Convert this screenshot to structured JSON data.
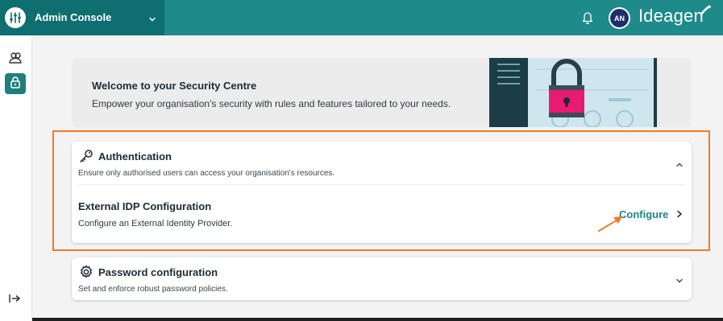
{
  "header": {
    "app_title": "Admin Console",
    "brand": "Ideagen",
    "avatar_initials": "AN",
    "colors": {
      "bar": "#1f8a8a",
      "switcher": "#0e6e70",
      "avatar": "#1b2f6e"
    }
  },
  "sidebar": {
    "items": [
      {
        "name": "users",
        "icon": "users-icon"
      },
      {
        "name": "security",
        "icon": "lock-icon",
        "active": true
      }
    ],
    "footer_icon": "expand-icon"
  },
  "banner": {
    "title": "Welcome to your Security Centre",
    "subtitle": "Empower your organisation's security with rules and features tailored to your needs."
  },
  "sections": {
    "authentication": {
      "title": "Authentication",
      "description": "Ensure only authorised users can access your organisation's resources.",
      "icon": "key-icon",
      "expanded": true,
      "item": {
        "title": "External IDP Configuration",
        "description": "Configure an External Identity Provider.",
        "action_label": "Configure"
      }
    },
    "password": {
      "title": "Password configuration",
      "description": "Set and enforce robust password policies.",
      "icon": "gear-icon",
      "expanded": false
    }
  },
  "accent": {
    "highlight": "#f07a2a",
    "link": "#1c8585"
  }
}
